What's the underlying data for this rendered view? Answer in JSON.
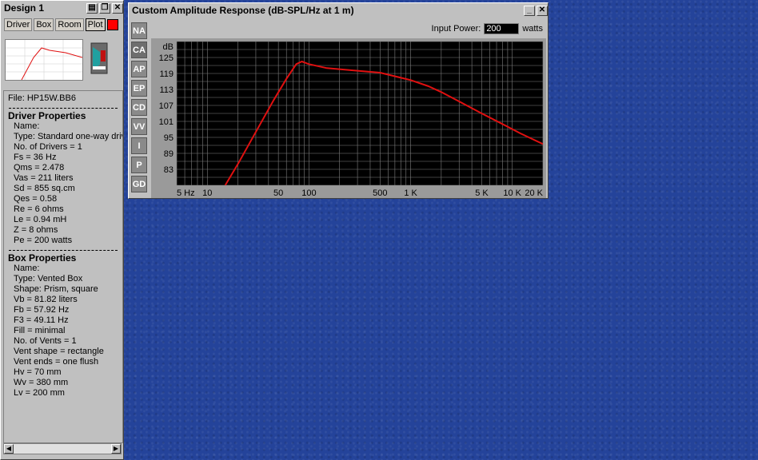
{
  "design": {
    "title": "Design 1",
    "tabs": [
      "Driver",
      "Box",
      "Room",
      "Plot"
    ],
    "file": "File: HP15W.BB6",
    "driver_header": "Driver Properties",
    "driver_lines": [
      "Name:",
      "Type: Standard one-way driv",
      "No. of Drivers = 1",
      "Fs = 36 Hz",
      "Qms = 2.478",
      "Vas = 211 liters",
      "Sd = 855 sq.cm",
      "Qes = 0.58",
      "Re = 6 ohms",
      "Le = 0.94 mH",
      "Z = 8 ohms",
      "Pe = 200 watts"
    ],
    "box_header": "Box Properties",
    "box_lines": [
      "Name:",
      "Type: Vented Box",
      "Shape: Prism, square",
      "Vb = 81.82 liters",
      "Fb = 57.92 Hz",
      "F3 = 49.11 Hz",
      "Fill = minimal",
      "No. of Vents = 1",
      "Vent shape = rectangle",
      "Vent ends = one flush",
      "Hv = 70 mm",
      "Wv = 380 mm",
      "Lv = 200 mm"
    ]
  },
  "chart_window": {
    "title": "Custom Amplitude Response (dB-SPL/Hz at 1 m)",
    "side_buttons": [
      "NA",
      "CA",
      "AP",
      "EP",
      "CD",
      "VV",
      "I",
      "P",
      "GD"
    ],
    "input_power_label": "Input Power:",
    "input_power_value": "200",
    "input_power_unit": "watts"
  },
  "chart_data": {
    "type": "line",
    "ylabel": "dB",
    "x_scale": "log",
    "xlim": [
      5,
      20000
    ],
    "ylim": [
      77,
      131
    ],
    "y_ticks": [
      83,
      89,
      95,
      101,
      107,
      113,
      119,
      125
    ],
    "x_tick_labels": [
      {
        "v": 5,
        "label": "5 Hz"
      },
      {
        "v": 10,
        "label": "10"
      },
      {
        "v": 50,
        "label": "50"
      },
      {
        "v": 100,
        "label": "100"
      },
      {
        "v": 500,
        "label": "500"
      },
      {
        "v": 1000,
        "label": "1 K"
      },
      {
        "v": 5000,
        "label": "5 K"
      },
      {
        "v": 10000,
        "label": "10 K"
      },
      {
        "v": 20000,
        "label": "20 K"
      }
    ],
    "grid": true,
    "series": [
      {
        "color": "#e01010",
        "x": [
          15,
          20,
          30,
          45,
          60,
          75,
          85,
          100,
          150,
          250,
          500,
          1000,
          1500,
          2000,
          3000,
          5000,
          8000,
          12000,
          20000
        ],
        "y": [
          77,
          85,
          97,
          109,
          117,
          122.5,
          123.5,
          122.5,
          121,
          120.3,
          119.3,
          116.5,
          114.2,
          112,
          108.5,
          104,
          100,
          96.5,
          92.5
        ]
      }
    ]
  },
  "colors": {
    "plot_bg": "#000000",
    "grid": "#7f7f7f",
    "desktop": "#24439a"
  }
}
